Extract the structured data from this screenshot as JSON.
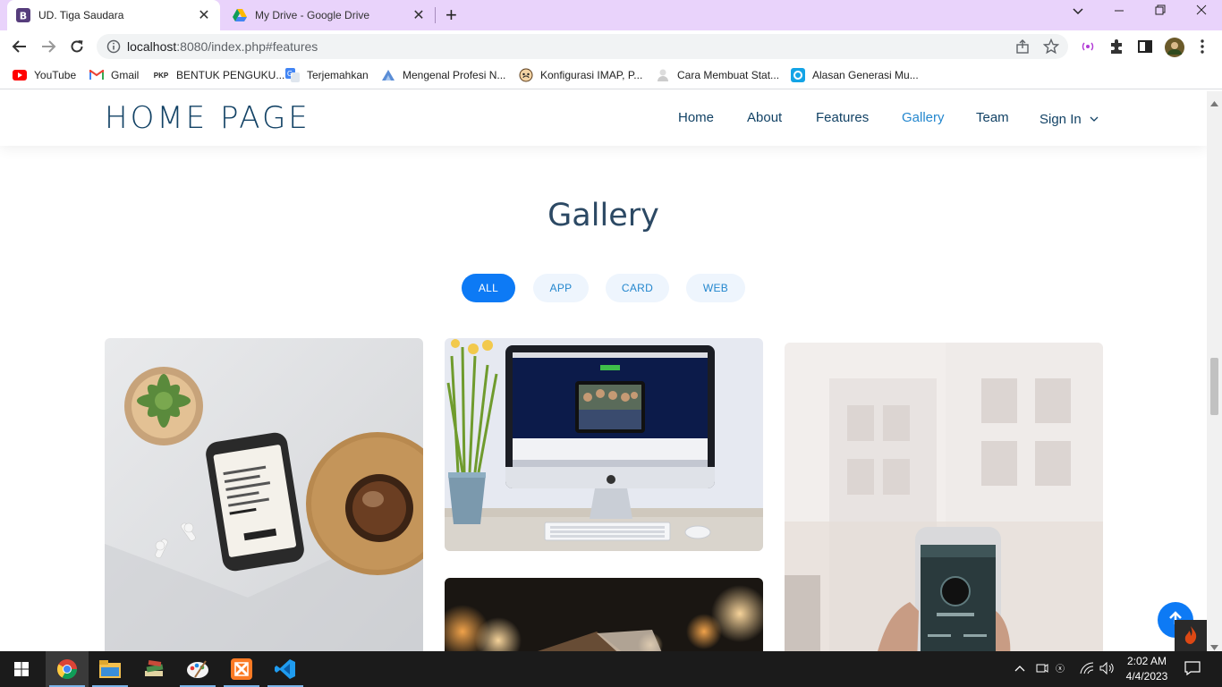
{
  "browser": {
    "tabs": [
      {
        "title": "UD. Tiga Saudara",
        "active": true
      },
      {
        "title": "My Drive - Google Drive",
        "active": false
      }
    ],
    "url_host": "localhost",
    "url_rest": ":8080/index.php#features",
    "bookmarks": [
      {
        "label": "YouTube",
        "icon": "youtube-icon"
      },
      {
        "label": "Gmail",
        "icon": "gmail-icon"
      },
      {
        "label": "BENTUK PENGUKU...",
        "icon": "pkp-icon"
      },
      {
        "label": "Terjemahkan",
        "icon": "translate-icon"
      },
      {
        "label": "Mengenal Profesi N...",
        "icon": "site-icon"
      },
      {
        "label": "Konfigurasi IMAP, P...",
        "icon": "site-icon"
      },
      {
        "label": "Cara Membuat Stat...",
        "icon": "site-icon"
      },
      {
        "label": "Alasan Generasi Mu...",
        "icon": "site-icon"
      }
    ]
  },
  "page": {
    "logo": "HOME PAGE",
    "nav": [
      "Home",
      "About",
      "Features",
      "Gallery",
      "Team",
      "Sign In"
    ],
    "active_nav": "Gallery",
    "section_title": "Gallery",
    "filters": [
      "ALL",
      "APP",
      "CARD",
      "WEB"
    ],
    "active_filter": "ALL",
    "gallery_items": [
      {
        "name": "gallery-phone-on-desk"
      },
      {
        "name": "gallery-imac-with-flowers"
      },
      {
        "name": "gallery-phone-in-hand"
      },
      {
        "name": "gallery-blurred-cards"
      }
    ]
  },
  "taskbar": {
    "time": "2:02 AM",
    "date": "4/4/2023"
  },
  "colors": {
    "accent": "#0d7af5",
    "nav_text": "#124265",
    "nav_active": "#2487ce",
    "title_text": "#2c4964",
    "tab_strip": "#e9d3fb"
  }
}
